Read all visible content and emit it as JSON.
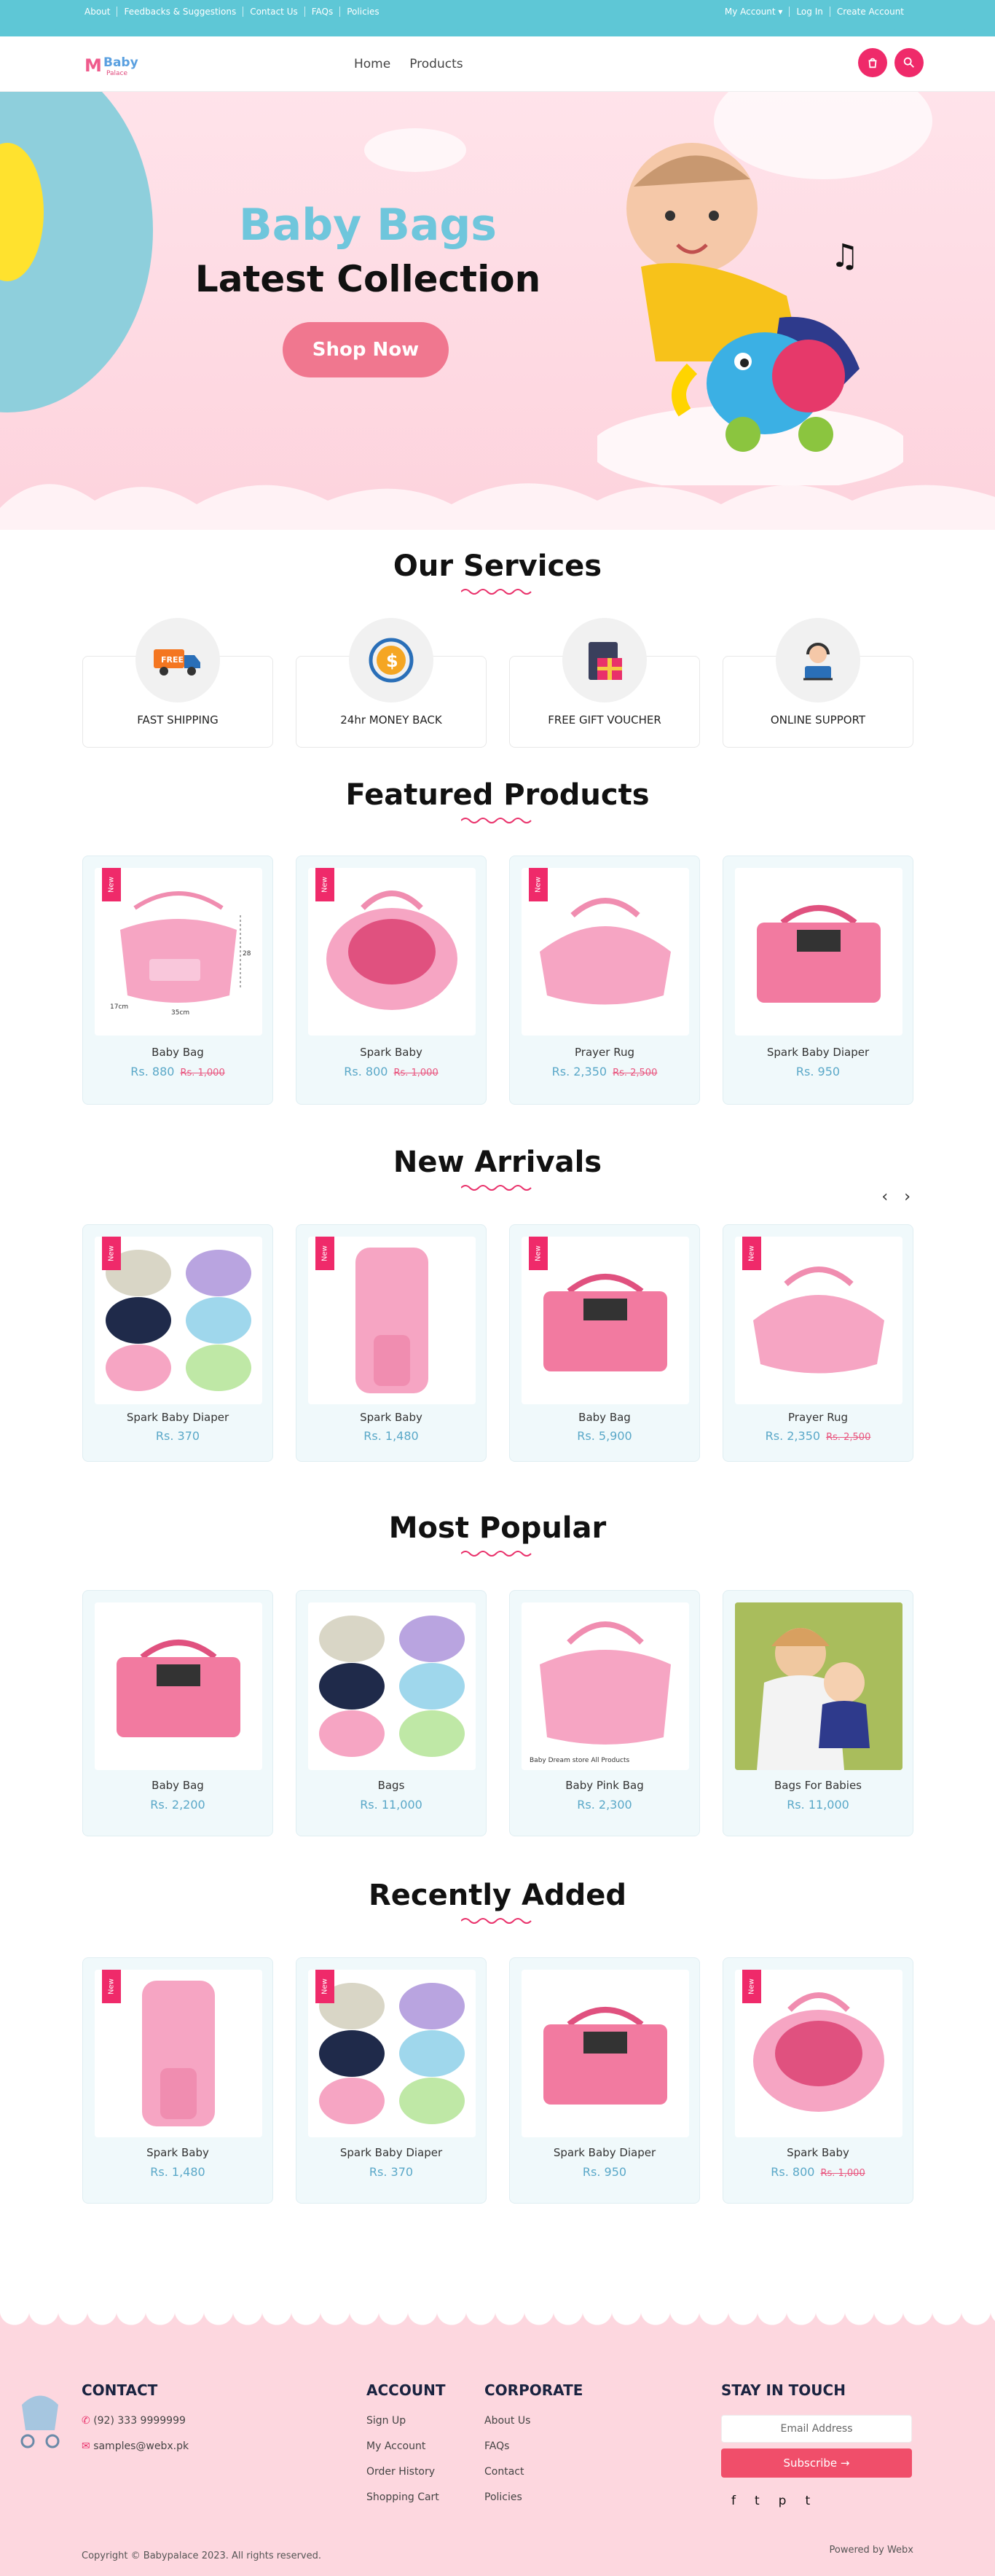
{
  "topbar": {
    "links": [
      "About",
      "Feedbacks & Suggestions",
      "Contact Us",
      "FAQs",
      "Policies"
    ],
    "account": "My Account ▾",
    "login": "Log In",
    "create": "Create Account"
  },
  "header": {
    "logo_main": "Baby",
    "logo_sub": "Palace",
    "nav": [
      "Home",
      "Products"
    ],
    "icons": [
      "cart-icon",
      "search-icon"
    ]
  },
  "hero": {
    "title": "Baby Bags",
    "subtitle": "Latest Collection",
    "cta": "Shop Now"
  },
  "services": {
    "title": "Our Services",
    "items": [
      {
        "label": "FAST SHIPPING",
        "icon": "truck-icon",
        "badge": "FREE"
      },
      {
        "label": "24hr MONEY BACK",
        "icon": "money-back-icon"
      },
      {
        "label": "FREE GIFT VOUCHER",
        "icon": "gift-icon"
      },
      {
        "label": "ONLINE SUPPORT",
        "icon": "support-icon"
      }
    ]
  },
  "featured": {
    "title": "Featured Products",
    "products": [
      {
        "name": "Baby Bag",
        "price": "Rs. 880",
        "old": "Rs. 1,000",
        "badge": "New",
        "dims": [
          "28cm",
          "35cm",
          "17cm"
        ]
      },
      {
        "name": "Spark Baby",
        "price": "Rs. 800",
        "old": "Rs. 1,000",
        "badge": "New"
      },
      {
        "name": "Prayer Rug",
        "price": "Rs. 2,350",
        "old": "Rs. 2,500",
        "badge": "New"
      },
      {
        "name": "Spark Baby Diaper",
        "price": "Rs. 950",
        "old": "",
        "badge": ""
      }
    ]
  },
  "arrivals": {
    "title": "New Arrivals",
    "products": [
      {
        "name": "Spark Baby Diaper",
        "price": "Rs. 370",
        "old": "",
        "badge": "New"
      },
      {
        "name": "Spark Baby",
        "price": "Rs. 1,480",
        "old": "",
        "badge": "New"
      },
      {
        "name": "Baby Bag",
        "price": "Rs. 5,900",
        "old": "",
        "badge": "New"
      },
      {
        "name": "Prayer Rug",
        "price": "Rs. 2,350",
        "old": "Rs. 2,500",
        "badge": "New"
      }
    ]
  },
  "popular": {
    "title": "Most Popular",
    "products": [
      {
        "name": "Baby Bag",
        "price": "Rs. 2,200",
        "old": "",
        "badge": ""
      },
      {
        "name": "Bags",
        "price": "Rs. 11,000",
        "old": "",
        "badge": ""
      },
      {
        "name": "Baby Pink Bag",
        "price": "Rs. 2,300",
        "old": "",
        "badge": "",
        "caption": "Baby Dream store All Products"
      },
      {
        "name": "Bags For Babies",
        "price": "Rs. 11,000",
        "old": "",
        "badge": ""
      }
    ]
  },
  "recent": {
    "title": "Recently Added",
    "products": [
      {
        "name": "Spark Baby",
        "price": "Rs. 1,480",
        "old": "",
        "badge": "New"
      },
      {
        "name": "Spark Baby Diaper",
        "price": "Rs. 370",
        "old": "",
        "badge": "New"
      },
      {
        "name": "Spark Baby Diaper",
        "price": "Rs. 950",
        "old": "",
        "badge": ""
      },
      {
        "name": "Spark Baby",
        "price": "Rs. 800",
        "old": "Rs. 1,000",
        "badge": "New"
      }
    ]
  },
  "footer": {
    "contact_title": "CONTACT",
    "phone": "(92) 333 9999999",
    "email": "samples@webx.pk",
    "account_title": "ACCOUNT",
    "account_links": [
      "Sign Up",
      "My Account",
      "Order History",
      "Shopping Cart"
    ],
    "corporate_title": "CORPORATE",
    "corporate_links": [
      "About Us",
      "FAQs",
      "Contact",
      "Policies"
    ],
    "stay_title": "STAY IN TOUCH",
    "email_placeholder": "Email Address",
    "subscribe": "Subscribe →",
    "social": [
      "f",
      "t",
      "p",
      "t"
    ],
    "copyright": "Copyright © Babypalace 2023. All rights reserved.",
    "powered": "Powered by Webx"
  },
  "colors": {
    "accent": "#ef2a6a",
    "teal": "#5ec7d6",
    "hero_title": "#6fc6dc"
  }
}
